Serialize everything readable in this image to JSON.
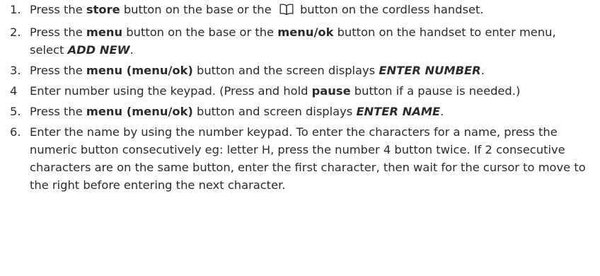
{
  "steps": [
    {
      "number": "1.",
      "segments": [
        {
          "t": "Press the ",
          "s": "n"
        },
        {
          "t": "store",
          "s": "b"
        },
        {
          "t": " button on the base or the ",
          "s": "n"
        },
        {
          "icon": "book-icon"
        },
        {
          "t": " button on the cordless handset.",
          "s": "n"
        }
      ]
    },
    {
      "number": "2.",
      "segments": [
        {
          "t": "Press the ",
          "s": "n"
        },
        {
          "t": "menu",
          "s": "b"
        },
        {
          "t": " button on the base or the ",
          "s": "n"
        },
        {
          "t": "menu/ok",
          "s": "b"
        },
        {
          "t": " button on the handset to enter menu, select ",
          "s": "n"
        },
        {
          "t": "ADD NEW",
          "s": "bi"
        },
        {
          "t": ".",
          "s": "n"
        }
      ]
    },
    {
      "number": "3.",
      "segments": [
        {
          "t": "Press the ",
          "s": "n"
        },
        {
          "t": "menu (menu/ok)",
          "s": "b"
        },
        {
          "t": " button and the screen displays ",
          "s": "n"
        },
        {
          "t": "ENTER NUMBER",
          "s": "bi"
        },
        {
          "t": ".",
          "s": "n"
        }
      ]
    },
    {
      "number": "4",
      "segments": [
        {
          "t": "Enter number using the keypad. (Press and hold ",
          "s": "n"
        },
        {
          "t": "pause",
          "s": "b"
        },
        {
          "t": " button if a pause is needed.)",
          "s": "n"
        }
      ]
    },
    {
      "number": "5.",
      "segments": [
        {
          "t": "Press the ",
          "s": "n"
        },
        {
          "t": "menu (menu/ok)",
          "s": "b"
        },
        {
          "t": " button and screen displays ",
          "s": "n"
        },
        {
          "t": "ENTER NAME",
          "s": "bi"
        },
        {
          "t": ".",
          "s": "n"
        }
      ]
    },
    {
      "number": "6.",
      "segments": [
        {
          "t": "Enter the name by using the number keypad. To enter the characters for a name, press the numeric button consecutively eg: letter H, press the number 4 button twice. If 2 consecutive characters are on the same button, enter the first character, then wait for the cursor to move to the right before entering the next character.",
          "s": "n"
        }
      ]
    }
  ]
}
